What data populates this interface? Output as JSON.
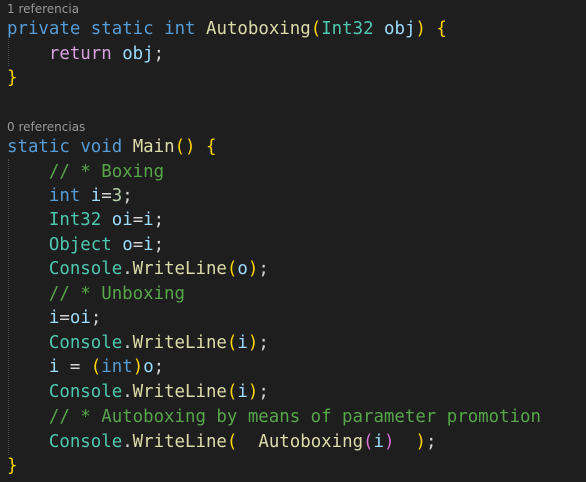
{
  "editor": {
    "lens_autoboxing": "1 referencia",
    "lens_main": "0 referencias",
    "sig1": {
      "private": "private",
      "static": "static",
      "int": "int",
      "name": "Autoboxing",
      "param_type": "Int32",
      "param_name": "obj"
    },
    "body1": {
      "return": "return",
      "obj": "obj"
    },
    "sig2": {
      "static": "static",
      "void": "void",
      "name": "Main"
    },
    "comment_boxing": "// * Boxing",
    "l_int": "int",
    "v_i": "i",
    "n_3": "3",
    "t_int32": "Int32",
    "v_oi": "oi",
    "t_object": "Object",
    "v_o": "o",
    "t_console": "Console",
    "m_writeline": "WriteLine",
    "comment_unboxing": "// * Unboxing",
    "comment_autoboxing": "// * Autoboxing by means of parameter promotion",
    "m_autoboxing": "Autoboxing"
  }
}
